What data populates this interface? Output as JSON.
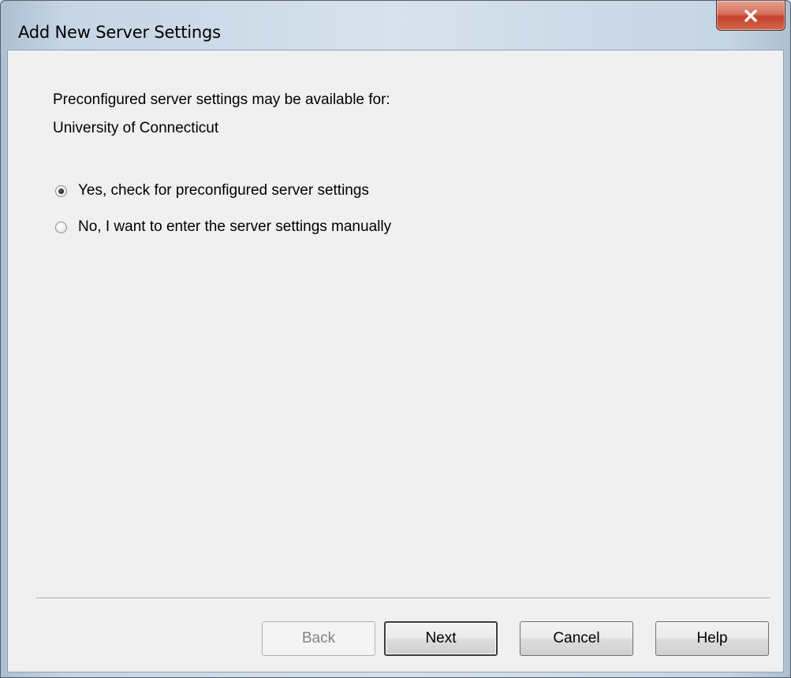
{
  "window": {
    "title": "Add New Server Settings"
  },
  "content": {
    "intro_line1": "Preconfigured server settings may be available for:",
    "intro_line2": "University of Connecticut"
  },
  "options": [
    {
      "label": "Yes, check for preconfigured server settings",
      "selected": true
    },
    {
      "label": "No, I want to enter the server settings manually",
      "selected": false
    }
  ],
  "buttons": {
    "back": {
      "label": "Back",
      "enabled": false
    },
    "next": {
      "label": "Next",
      "enabled": true,
      "default": true
    },
    "cancel": {
      "label": "Cancel",
      "enabled": true
    },
    "help": {
      "label": "Help",
      "enabled": true
    }
  },
  "colors": {
    "dialog_background": "#f0f0f0",
    "close_button": "#c3402a",
    "frame": "#c6d5e4"
  }
}
